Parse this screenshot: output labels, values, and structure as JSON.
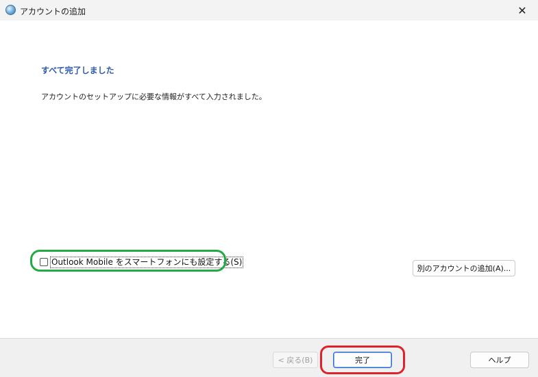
{
  "window": {
    "title": "アカウントの追加",
    "app_icon": "globe-icon",
    "close_glyph": "✕"
  },
  "content": {
    "heading": "すべて完了しました",
    "description": "アカウントのセットアップに必要な情報がすべて入力されました。"
  },
  "options": {
    "outlook_mobile_label": "Outlook Mobile をスマートフォンにも設定する(S)",
    "outlook_mobile_checked": false,
    "add_another_account_label": "別のアカウントの追加(A)..."
  },
  "footer": {
    "back_label": "< 戻る(B)",
    "finish_label": "完了",
    "help_label": "ヘルプ"
  },
  "annotations": {
    "highlight_checkbox_color": "#22aa44",
    "highlight_finish_color": "#e0202a"
  }
}
